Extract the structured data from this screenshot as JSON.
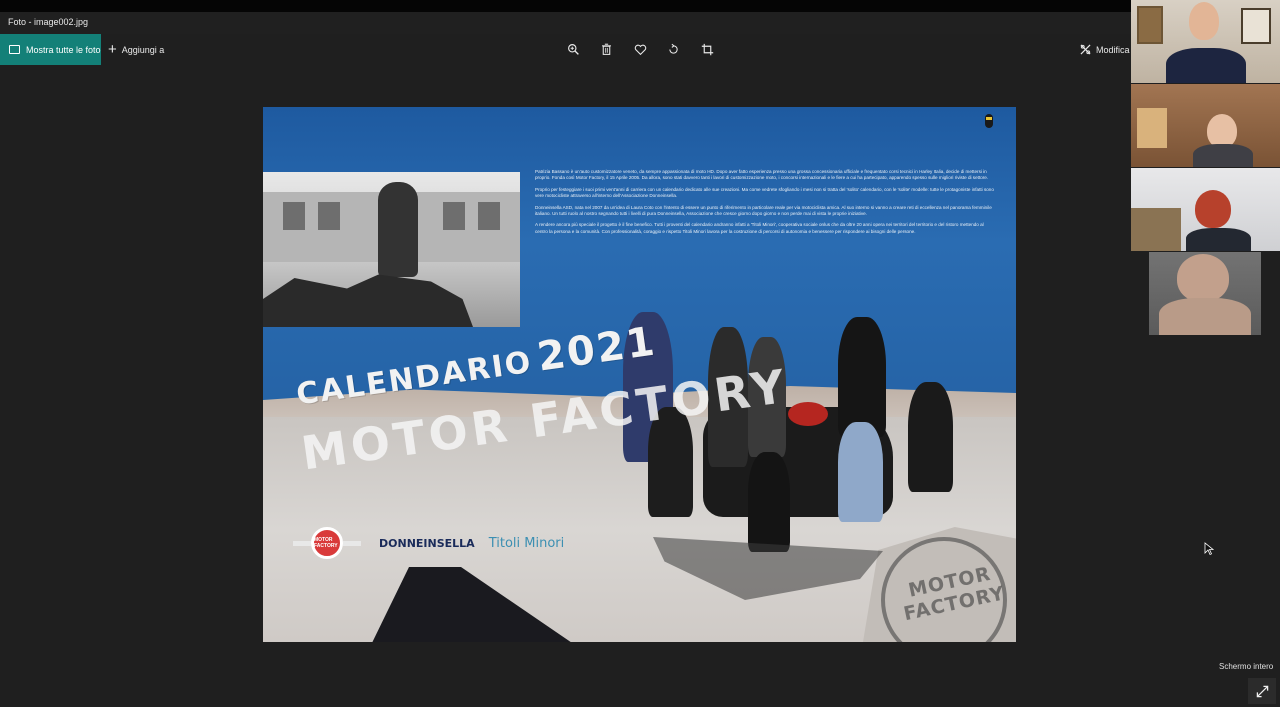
{
  "window": {
    "title": "Foto - image002.jpg"
  },
  "toolbar": {
    "show_all_label": "Mostra tutte le foto",
    "add_to_label": "Aggiungi a",
    "edit_label": "Modifica",
    "tools": [
      "zoom-icon",
      "delete-icon",
      "favorite-icon",
      "rotate-icon",
      "crop-icon"
    ]
  },
  "photo": {
    "calendar_word": "CALENDARIO",
    "calendar_year": "2021",
    "brand": "MOTOR FACTORY",
    "logos": {
      "logo1": "MOTOR FACTORY",
      "logo2": "DONNEINSELLA",
      "logo3": "Titoli Minori"
    },
    "seal_text": "MOTOR FACTORY",
    "paragraphs": [
      "Patrizia Bassano è un'auto customizzatore veneto, da sempre appassionata di moto HD. Dopo aver fatto esperienza presso una grossa concessionaria ufficiale e frequentato corsi tecnici in Harley Italia, decide di mettersi in proprio. Fonda così Motor Factory, il 15 Aprile 2005. Da allora, sono stati davvero tanti i lavori di customizzazione moto, i concorsi internazionali e le fiere a cui ha partecipato, apparendo spesso sulle migliori riviste di settore.",
      "Proprio per festeggiare i suoi primi vent'anni di carriera con un calendario dedicato alle sue creazioni. Ma come vedrete sfogliando i mesi non si tratta del 'solito' calendario, con le 'solite' modelle: tutte le protagoniste infatti sono vere motocicliste attraverso all'interno dell'Associazione Donneinsella.",
      "Donneinsella ASD, nata nel 2007 da un'idea di Laura Coto con l'intento di essere un punto di riferimento in particolare reale per via motociclista amica. Al suo interno si vanno a creare reti di eccellenza nel panorama femminile italiano. Un tutti ruolo al nostro segnando tutti i livelli di pura Donneinsella, Associazione che cresce giorno dopo giorno e non perde mai di vista le proprie iniziative.",
      "A rendere ancora più speciale il progetto è il fine benefico. Tutti i proventi del calendario andranno infatti a 'Titoli Minori', cooperativa sociale onlus che da oltre 20 anni opera nei territori del territorio e del ristoro mettendo al centro la persona e la comunità. Con professionalità, coraggio e rispetto Titoli Minori lavora per la costruzione di percorsi di autonomia e benessere per rispondere ai bisogni delle persone."
    ]
  },
  "video_tiles": [
    "participant-1",
    "participant-2",
    "participant-3",
    "participant-4"
  ],
  "fullscreen": {
    "label": "Schermo intero"
  },
  "colors": {
    "accent": "#138078",
    "background": "#1f1f1f"
  }
}
